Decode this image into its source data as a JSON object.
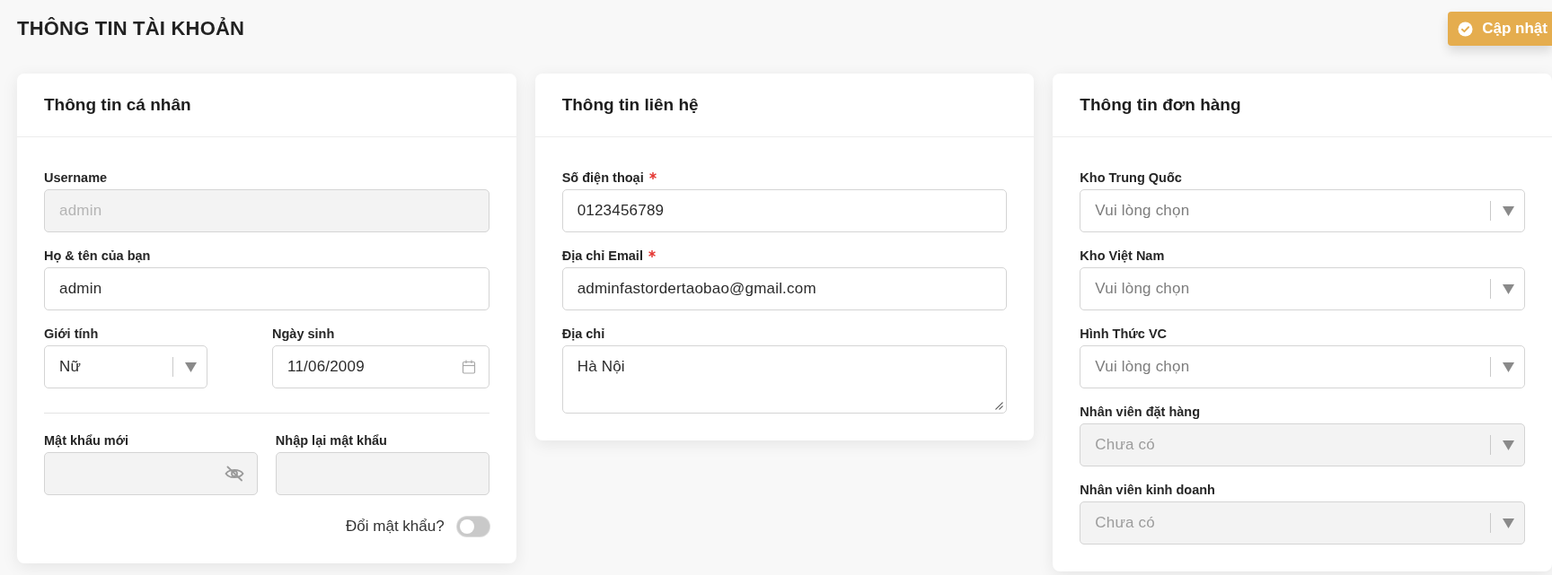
{
  "page": {
    "title": "THÔNG TIN TÀI KHOẢN"
  },
  "update_button": {
    "label": "Cập nhật"
  },
  "cards": [
    {
      "title": "Thông tin cá nhân",
      "rows": [
        {
          "kind": "fields",
          "fields": [
            {
              "kind": "text",
              "label": "Username",
              "value": "admin",
              "disabled": true,
              "required": false
            }
          ]
        },
        {
          "kind": "fields",
          "fields": [
            {
              "kind": "text",
              "label": "Họ & tên của bạn",
              "value": "admin",
              "disabled": false,
              "required": false
            }
          ]
        },
        {
          "kind": "fields",
          "fields": [
            {
              "kind": "select",
              "label": "Giới tính",
              "value": "Nữ",
              "disabled": false,
              "required": false
            },
            {
              "kind": "date",
              "label": "Ngày sinh",
              "value": "11/06/2009",
              "disabled": false,
              "required": false
            }
          ]
        },
        {
          "kind": "divider"
        },
        {
          "kind": "fields",
          "fields": [
            {
              "kind": "password",
              "label": "Mật khẩu mới",
              "disabled": true,
              "required": false
            },
            {
              "kind": "text",
              "label": "Nhập lại mật khẩu",
              "disabled": true,
              "required": false
            }
          ]
        },
        {
          "kind": "toggle",
          "label": "Đổi mật khẩu?",
          "on": false
        }
      ]
    },
    {
      "title": "Thông tin liên hệ",
      "rows": [
        {
          "kind": "fields",
          "fields": [
            {
              "kind": "text",
              "label": "Số điện thoại",
              "value": "0123456789",
              "disabled": false,
              "required": true
            }
          ]
        },
        {
          "kind": "fields",
          "fields": [
            {
              "kind": "text",
              "label": "Địa chỉ Email",
              "value": "adminfastordertaobao@gmail.com",
              "disabled": false,
              "required": true
            }
          ]
        },
        {
          "kind": "fields",
          "fields": [
            {
              "kind": "textarea",
              "label": "Địa chỉ",
              "value": "Hà Nội",
              "disabled": false,
              "required": false
            }
          ]
        }
      ]
    },
    {
      "title": "Thông tin đơn hàng",
      "rows": [
        {
          "kind": "fields",
          "fields": [
            {
              "kind": "select",
              "label": "Kho Trung Quốc",
              "placeholder": "Vui lòng chọn",
              "disabled": false,
              "required": false
            }
          ]
        },
        {
          "kind": "fields",
          "fields": [
            {
              "kind": "select",
              "label": "Kho Việt Nam",
              "placeholder": "Vui lòng chọn",
              "disabled": false,
              "required": false
            }
          ]
        },
        {
          "kind": "fields",
          "fields": [
            {
              "kind": "select",
              "label": "Hình Thức VC",
              "placeholder": "Vui lòng chọn",
              "disabled": false,
              "required": false
            }
          ]
        },
        {
          "kind": "fields",
          "fields": [
            {
              "kind": "select",
              "label": "Nhân viên đặt hàng",
              "placeholder": "Chưa có",
              "disabled": true,
              "required": false
            }
          ]
        },
        {
          "kind": "fields",
          "fields": [
            {
              "kind": "select",
              "label": "Nhân viên kinh doanh",
              "placeholder": "Chưa có",
              "disabled": true,
              "required": false
            }
          ]
        }
      ]
    }
  ]
}
